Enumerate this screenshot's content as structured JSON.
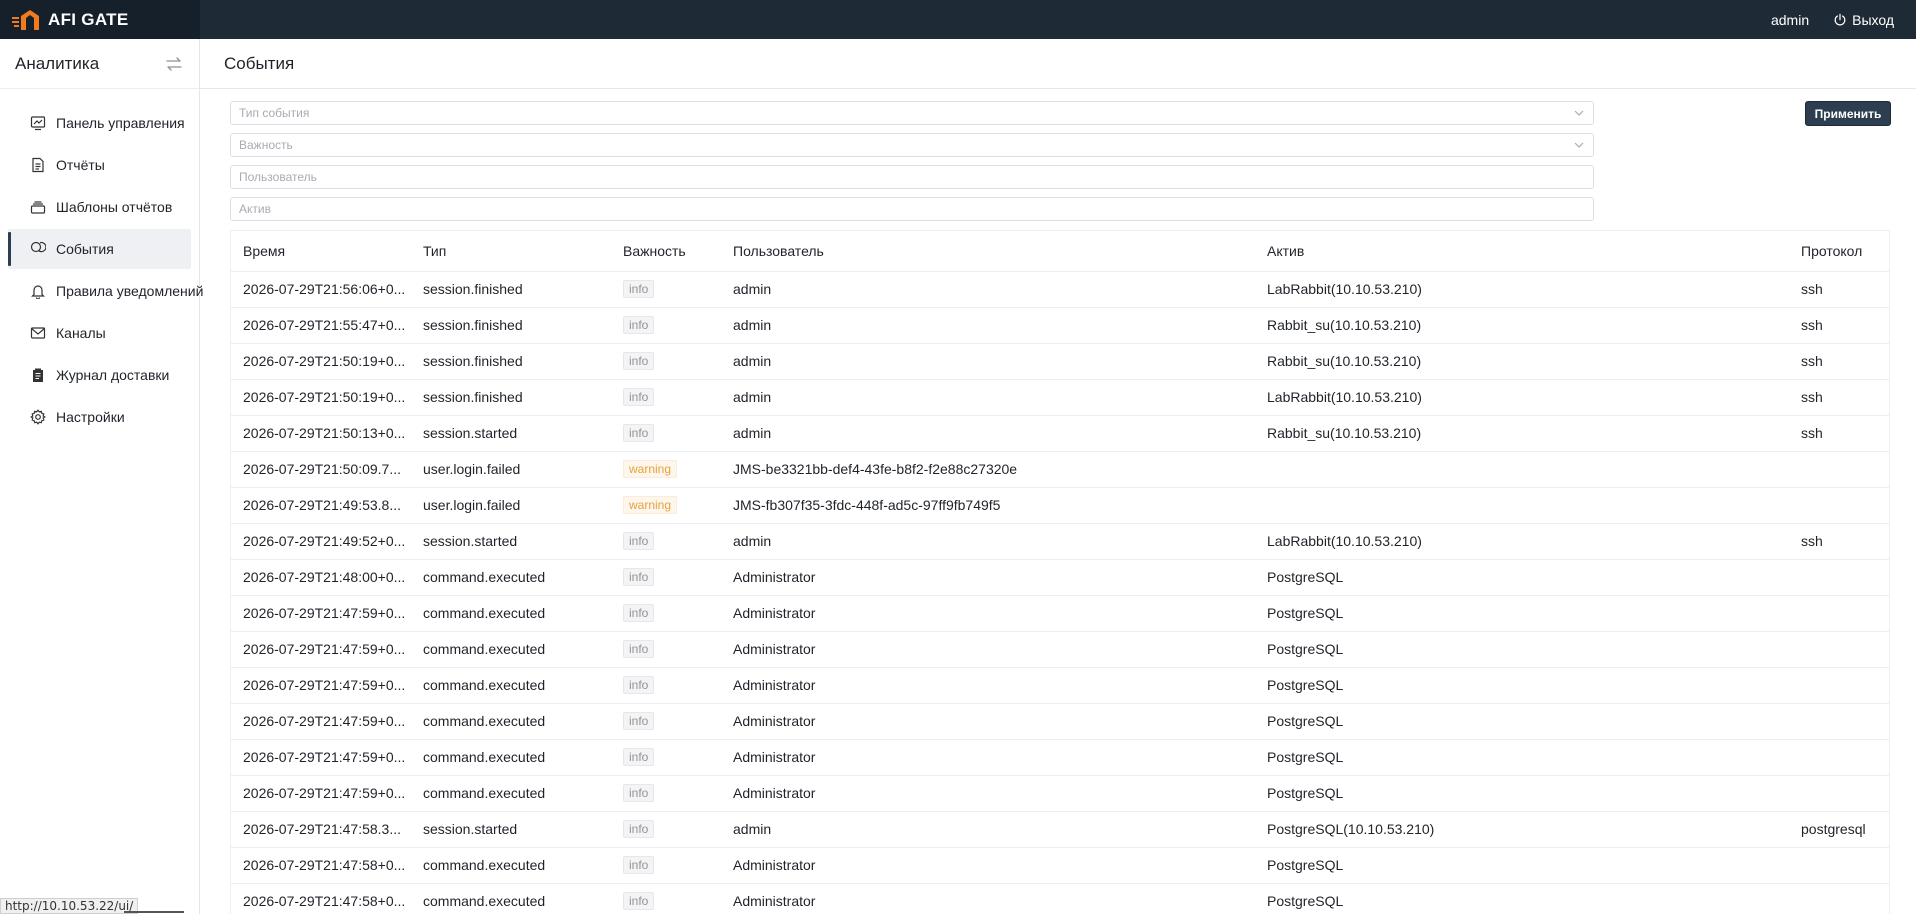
{
  "app": {
    "name": "AFI GATE",
    "user": "admin",
    "logout_label": "Выход"
  },
  "sidebar": {
    "title": "Аналитика",
    "items": [
      {
        "label": "Панель управления",
        "icon": "dashboard-icon",
        "active": false
      },
      {
        "label": "Отчёты",
        "icon": "file-icon",
        "active": false
      },
      {
        "label": "Шаблоны отчётов",
        "icon": "stack-icon",
        "active": false
      },
      {
        "label": "События",
        "icon": "events-icon",
        "active": true
      },
      {
        "label": "Правила уведомлений",
        "icon": "bell-icon",
        "active": false
      },
      {
        "label": "Каналы",
        "icon": "mail-icon",
        "active": false
      },
      {
        "label": "Журнал доставки",
        "icon": "clipboard-icon",
        "active": false
      },
      {
        "label": "Настройки",
        "icon": "gear-icon",
        "active": false
      }
    ]
  },
  "page": {
    "title": "События"
  },
  "filters": {
    "event_type_placeholder": "Тип события",
    "severity_placeholder": "Важность",
    "user_placeholder": "Пользователь",
    "asset_placeholder": "Актив",
    "apply_label": "Применить"
  },
  "table": {
    "columns": [
      "Время",
      "Тип",
      "Важность",
      "Пользователь",
      "Актив",
      "Протокол"
    ],
    "rows": [
      {
        "time": "2026-07-29T21:56:06+0...",
        "type": "session.finished",
        "severity": "info",
        "user": "admin",
        "asset": "LabRabbit(10.10.53.210)",
        "protocol": "ssh"
      },
      {
        "time": "2026-07-29T21:55:47+0...",
        "type": "session.finished",
        "severity": "info",
        "user": "admin",
        "asset": "Rabbit_su(10.10.53.210)",
        "protocol": "ssh"
      },
      {
        "time": "2026-07-29T21:50:19+0...",
        "type": "session.finished",
        "severity": "info",
        "user": "admin",
        "asset": "Rabbit_su(10.10.53.210)",
        "protocol": "ssh"
      },
      {
        "time": "2026-07-29T21:50:19+0...",
        "type": "session.finished",
        "severity": "info",
        "user": "admin",
        "asset": "LabRabbit(10.10.53.210)",
        "protocol": "ssh"
      },
      {
        "time": "2026-07-29T21:50:13+0...",
        "type": "session.started",
        "severity": "info",
        "user": "admin",
        "asset": "Rabbit_su(10.10.53.210)",
        "protocol": "ssh"
      },
      {
        "time": "2026-07-29T21:50:09.7...",
        "type": "user.login.failed",
        "severity": "warning",
        "user": "JMS-be3321bb-def4-43fe-b8f2-f2e88c27320e",
        "asset": "",
        "protocol": ""
      },
      {
        "time": "2026-07-29T21:49:53.8...",
        "type": "user.login.failed",
        "severity": "warning",
        "user": "JMS-fb307f35-3fdc-448f-ad5c-97ff9fb749f5",
        "asset": "",
        "protocol": ""
      },
      {
        "time": "2026-07-29T21:49:52+0...",
        "type": "session.started",
        "severity": "info",
        "user": "admin",
        "asset": "LabRabbit(10.10.53.210)",
        "protocol": "ssh"
      },
      {
        "time": "2026-07-29T21:48:00+0...",
        "type": "command.executed",
        "severity": "info",
        "user": "Administrator",
        "asset": "PostgreSQL",
        "protocol": ""
      },
      {
        "time": "2026-07-29T21:47:59+0...",
        "type": "command.executed",
        "severity": "info",
        "user": "Administrator",
        "asset": "PostgreSQL",
        "protocol": ""
      },
      {
        "time": "2026-07-29T21:47:59+0...",
        "type": "command.executed",
        "severity": "info",
        "user": "Administrator",
        "asset": "PostgreSQL",
        "protocol": ""
      },
      {
        "time": "2026-07-29T21:47:59+0...",
        "type": "command.executed",
        "severity": "info",
        "user": "Administrator",
        "asset": "PostgreSQL",
        "protocol": ""
      },
      {
        "time": "2026-07-29T21:47:59+0...",
        "type": "command.executed",
        "severity": "info",
        "user": "Administrator",
        "asset": "PostgreSQL",
        "protocol": ""
      },
      {
        "time": "2026-07-29T21:47:59+0...",
        "type": "command.executed",
        "severity": "info",
        "user": "Administrator",
        "asset": "PostgreSQL",
        "protocol": ""
      },
      {
        "time": "2026-07-29T21:47:59+0...",
        "type": "command.executed",
        "severity": "info",
        "user": "Administrator",
        "asset": "PostgreSQL",
        "protocol": ""
      },
      {
        "time": "2026-07-29T21:47:58.3...",
        "type": "session.started",
        "severity": "info",
        "user": "admin",
        "asset": "PostgreSQL(10.10.53.210)",
        "protocol": "postgresql"
      },
      {
        "time": "2026-07-29T21:47:58+0...",
        "type": "command.executed",
        "severity": "info",
        "user": "Administrator",
        "asset": "PostgreSQL",
        "protocol": ""
      },
      {
        "time": "2026-07-29T21:47:58+0...",
        "type": "command.executed",
        "severity": "info",
        "user": "Administrator",
        "asset": "PostgreSQL",
        "protocol": ""
      }
    ]
  },
  "statusbar": {
    "url": "http://10.10.53.22/ui/"
  },
  "colors": {
    "topbar": "#1e2a36",
    "accent": "#2c3e50",
    "warning": "#e6a23c",
    "brand_orange": "#f07c1e"
  }
}
